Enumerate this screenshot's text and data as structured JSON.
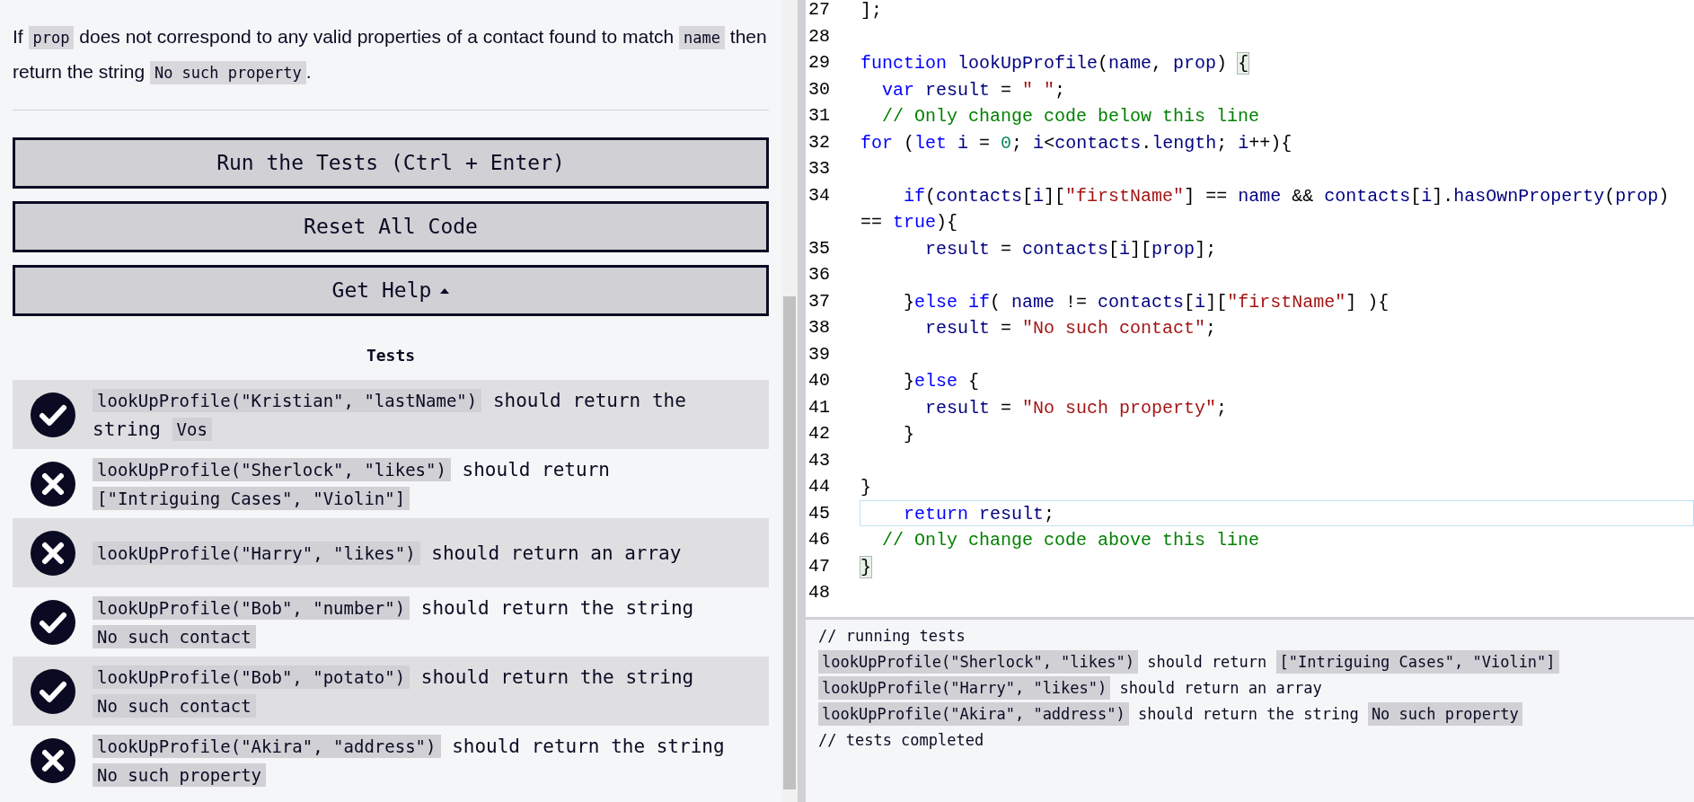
{
  "description": {
    "segments": [
      {
        "kind": "text",
        "text": "If "
      },
      {
        "kind": "code",
        "text": "prop"
      },
      {
        "kind": "text",
        "text": " does not correspond to any valid properties of a contact found to match "
      },
      {
        "kind": "code",
        "text": "name"
      },
      {
        "kind": "text",
        "text": " then return the string "
      },
      {
        "kind": "code",
        "text": "No such property"
      },
      {
        "kind": "text",
        "text": "."
      }
    ]
  },
  "buttons": [
    {
      "label": "Run the Tests (Ctrl + Enter)",
      "caret": false
    },
    {
      "label": "Reset All Code",
      "caret": false
    },
    {
      "label": "Get Help",
      "caret": true
    }
  ],
  "tests_heading": "Tests",
  "tests": [
    {
      "passed": true,
      "segments": [
        {
          "kind": "code",
          "text": "lookUpProfile(\"Kristian\", \"lastName\")"
        },
        {
          "kind": "text",
          "text": " should return the string "
        },
        {
          "kind": "code",
          "text": "Vos"
        }
      ]
    },
    {
      "passed": false,
      "segments": [
        {
          "kind": "code",
          "text": "lookUpProfile(\"Sherlock\", \"likes\")"
        },
        {
          "kind": "text",
          "text": " should return "
        },
        {
          "kind": "code",
          "text": "[\"Intriguing Cases\", \"Violin\"]"
        }
      ]
    },
    {
      "passed": false,
      "segments": [
        {
          "kind": "code",
          "text": "lookUpProfile(\"Harry\", \"likes\")"
        },
        {
          "kind": "text",
          "text": " should return an array"
        }
      ]
    },
    {
      "passed": true,
      "segments": [
        {
          "kind": "code",
          "text": "lookUpProfile(\"Bob\", \"number\")"
        },
        {
          "kind": "text",
          "text": " should return the string "
        },
        {
          "kind": "code",
          "text": "No such contact"
        }
      ]
    },
    {
      "passed": true,
      "segments": [
        {
          "kind": "code",
          "text": "lookUpProfile(\"Bob\", \"potato\")"
        },
        {
          "kind": "text",
          "text": " should return the string "
        },
        {
          "kind": "code",
          "text": "No such contact"
        }
      ]
    },
    {
      "passed": false,
      "segments": [
        {
          "kind": "code",
          "text": "lookUpProfile(\"Akira\", \"address\")"
        },
        {
          "kind": "text",
          "text": " should return the string "
        },
        {
          "kind": "code",
          "text": "No such property"
        }
      ]
    }
  ],
  "editor": {
    "lines": [
      {
        "number": "27",
        "active": false,
        "tokens": [
          {
            "kind": "plain",
            "text": "];"
          }
        ]
      },
      {
        "number": "28",
        "active": false
      },
      {
        "number": "29",
        "active": false,
        "tokens": [
          {
            "kind": "keyword",
            "text": "function"
          },
          {
            "kind": "variable",
            "text": " lookUpProfile"
          },
          {
            "kind": "plain",
            "text": "("
          },
          {
            "kind": "variable",
            "text": "name"
          },
          {
            "kind": "plain",
            "text": ", "
          },
          {
            "kind": "variable",
            "text": "prop"
          },
          {
            "kind": "plain",
            "text": ") "
          },
          {
            "kind": "match",
            "text": "{"
          }
        ]
      },
      {
        "number": "30",
        "active": false,
        "tokens": [
          {
            "kind": "keyword",
            "text": "  var"
          },
          {
            "kind": "variable",
            "text": " result"
          },
          {
            "kind": "plain",
            "text": " = "
          },
          {
            "kind": "string",
            "text": "\" \""
          },
          {
            "kind": "plain",
            "text": ";"
          }
        ]
      },
      {
        "number": "31",
        "active": false,
        "tokens": [
          {
            "kind": "comment",
            "text": "  // Only change code below this line"
          }
        ]
      },
      {
        "number": "32",
        "active": false,
        "tokens": [
          {
            "kind": "keyword",
            "text": "for"
          },
          {
            "kind": "plain",
            "text": " ("
          },
          {
            "kind": "keyword",
            "text": "let"
          },
          {
            "kind": "variable",
            "text": " i"
          },
          {
            "kind": "plain",
            "text": " = "
          },
          {
            "kind": "number",
            "text": "0"
          },
          {
            "kind": "plain",
            "text": "; "
          },
          {
            "kind": "variable",
            "text": "i"
          },
          {
            "kind": "plain",
            "text": "<"
          },
          {
            "kind": "variable",
            "text": "contacts"
          },
          {
            "kind": "plain",
            "text": "."
          },
          {
            "kind": "variable",
            "text": "length"
          },
          {
            "kind": "plain",
            "text": "; "
          },
          {
            "kind": "variable",
            "text": "i"
          },
          {
            "kind": "plain",
            "text": "++){"
          }
        ]
      },
      {
        "number": "33",
        "active": false
      },
      {
        "number": "34",
        "active": false,
        "tokens": [
          {
            "kind": "keyword",
            "text": "    if"
          },
          {
            "kind": "plain",
            "text": "("
          },
          {
            "kind": "variable",
            "text": "contacts"
          },
          {
            "kind": "plain",
            "text": "["
          },
          {
            "kind": "variable",
            "text": "i"
          },
          {
            "kind": "plain",
            "text": "]["
          },
          {
            "kind": "string",
            "text": "\"firstName\""
          },
          {
            "kind": "plain",
            "text": "] == "
          },
          {
            "kind": "variable",
            "text": "name"
          },
          {
            "kind": "plain",
            "text": " && "
          },
          {
            "kind": "variable",
            "text": "contacts"
          },
          {
            "kind": "plain",
            "text": "["
          },
          {
            "kind": "variable",
            "text": "i"
          },
          {
            "kind": "plain",
            "text": "]."
          },
          {
            "kind": "variable",
            "text": "hasOwnProperty"
          },
          {
            "kind": "plain",
            "text": "("
          },
          {
            "kind": "variable",
            "text": "prop"
          },
          {
            "kind": "plain",
            "text": ")"
          }
        ],
        "wrap": [
          {
            "kind": "plain",
            "text": "== "
          },
          {
            "kind": "keyword",
            "text": "true"
          },
          {
            "kind": "plain",
            "text": "){"
          }
        ]
      },
      {
        "number": "35",
        "active": false,
        "tokens": [
          {
            "kind": "variable",
            "text": "      result"
          },
          {
            "kind": "plain",
            "text": " = "
          },
          {
            "kind": "variable",
            "text": "contacts"
          },
          {
            "kind": "plain",
            "text": "["
          },
          {
            "kind": "variable",
            "text": "i"
          },
          {
            "kind": "plain",
            "text": "]["
          },
          {
            "kind": "variable",
            "text": "prop"
          },
          {
            "kind": "plain",
            "text": "];"
          }
        ]
      },
      {
        "number": "36",
        "active": false
      },
      {
        "number": "37",
        "active": false,
        "tokens": [
          {
            "kind": "plain",
            "text": "    }"
          },
          {
            "kind": "keyword",
            "text": "else if"
          },
          {
            "kind": "plain",
            "text": "( "
          },
          {
            "kind": "variable",
            "text": "name"
          },
          {
            "kind": "plain",
            "text": " != "
          },
          {
            "kind": "variable",
            "text": "contacts"
          },
          {
            "kind": "plain",
            "text": "["
          },
          {
            "kind": "variable",
            "text": "i"
          },
          {
            "kind": "plain",
            "text": "]["
          },
          {
            "kind": "string",
            "text": "\"firstName\""
          },
          {
            "kind": "plain",
            "text": "] ){"
          }
        ]
      },
      {
        "number": "38",
        "active": false,
        "tokens": [
          {
            "kind": "variable",
            "text": "      result"
          },
          {
            "kind": "plain",
            "text": " = "
          },
          {
            "kind": "string",
            "text": "\"No such contact\""
          },
          {
            "kind": "plain",
            "text": ";"
          }
        ]
      },
      {
        "number": "39",
        "active": false
      },
      {
        "number": "40",
        "active": false,
        "tokens": [
          {
            "kind": "plain",
            "text": "    }"
          },
          {
            "kind": "keyword",
            "text": "else"
          },
          {
            "kind": "plain",
            "text": " {"
          }
        ]
      },
      {
        "number": "41",
        "active": false,
        "tokens": [
          {
            "kind": "variable",
            "text": "      result"
          },
          {
            "kind": "plain",
            "text": " = "
          },
          {
            "kind": "string",
            "text": "\"No such property\""
          },
          {
            "kind": "plain",
            "text": ";"
          }
        ]
      },
      {
        "number": "42",
        "active": false,
        "tokens": [
          {
            "kind": "plain",
            "text": "    }"
          }
        ]
      },
      {
        "number": "43",
        "active": false
      },
      {
        "number": "44",
        "active": false,
        "tokens": [
          {
            "kind": "plain",
            "text": "}"
          }
        ]
      },
      {
        "number": "45",
        "active": true,
        "tokens": [
          {
            "kind": "keyword",
            "text": "    return"
          },
          {
            "kind": "variable",
            "text": " result"
          },
          {
            "kind": "plain",
            "text": ";"
          }
        ]
      },
      {
        "number": "46",
        "active": false,
        "tokens": [
          {
            "kind": "comment",
            "text": "  // Only change code above this line"
          }
        ]
      },
      {
        "number": "47",
        "active": false,
        "tokens": [
          {
            "kind": "match",
            "text": "}"
          }
        ]
      },
      {
        "number": "48",
        "active": false
      }
    ]
  },
  "console": {
    "lines": [
      {
        "segments": [
          {
            "kind": "text",
            "text": "// running tests"
          }
        ]
      },
      {
        "segments": [
          {
            "kind": "code",
            "text": "lookUpProfile(\"Sherlock\", \"likes\")"
          },
          {
            "kind": "text",
            "text": " should return "
          },
          {
            "kind": "code",
            "text": "[\"Intriguing Cases\", \"Violin\"]"
          }
        ]
      },
      {
        "segments": [
          {
            "kind": "code",
            "text": "lookUpProfile(\"Harry\", \"likes\")"
          },
          {
            "kind": "text",
            "text": " should return an array"
          }
        ]
      },
      {
        "segments": [
          {
            "kind": "code",
            "text": "lookUpProfile(\"Akira\", \"address\")"
          },
          {
            "kind": "text",
            "text": " should return the string "
          },
          {
            "kind": "code",
            "text": "No such property"
          }
        ]
      },
      {
        "segments": [
          {
            "kind": "text",
            "text": "// tests completed"
          }
        ]
      }
    ]
  }
}
